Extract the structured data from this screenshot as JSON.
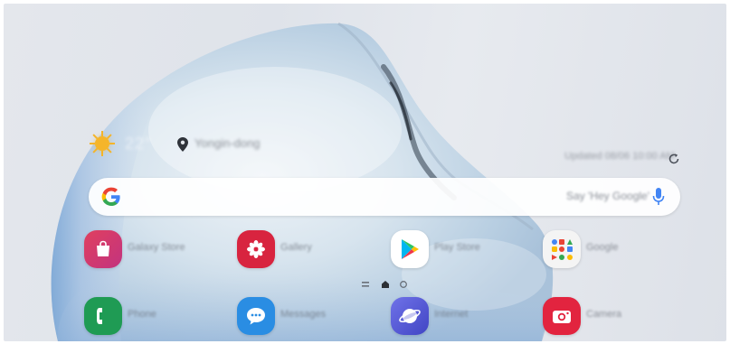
{
  "screen": {
    "accent": "#3b6fd4"
  },
  "weather": {
    "icon": "sun-icon",
    "temperature": "22°",
    "location": "Yongin-dong",
    "updated": "Updated 08/06 10:00 AM"
  },
  "search": {
    "placeholder": "Say 'Hey Google'",
    "logo": "google-g-icon",
    "mic": "mic-icon"
  },
  "apps": {
    "row1": [
      {
        "name": "Galaxy Store",
        "icon": "galaxy-store-icon",
        "color": "#e2416a"
      },
      {
        "name": "Gallery",
        "icon": "gallery-icon",
        "color": "#d8243f"
      },
      {
        "name": "Play Store",
        "icon": "play-store-icon",
        "color": "#ffffff"
      },
      {
        "name": "Google",
        "icon": "google-folder-icon",
        "color": "#f2f2f2"
      }
    ],
    "row2": [
      {
        "name": "Phone",
        "icon": "phone-icon",
        "color": "#1f9b54"
      },
      {
        "name": "Messages",
        "icon": "messages-icon",
        "color": "#2a8de3"
      },
      {
        "name": "Internet",
        "icon": "internet-icon",
        "color": "#5b5fd7"
      },
      {
        "name": "Camera",
        "icon": "camera-icon",
        "color": "#e2243f"
      }
    ]
  },
  "page_indicator": {
    "pages": 2,
    "current": 1
  }
}
